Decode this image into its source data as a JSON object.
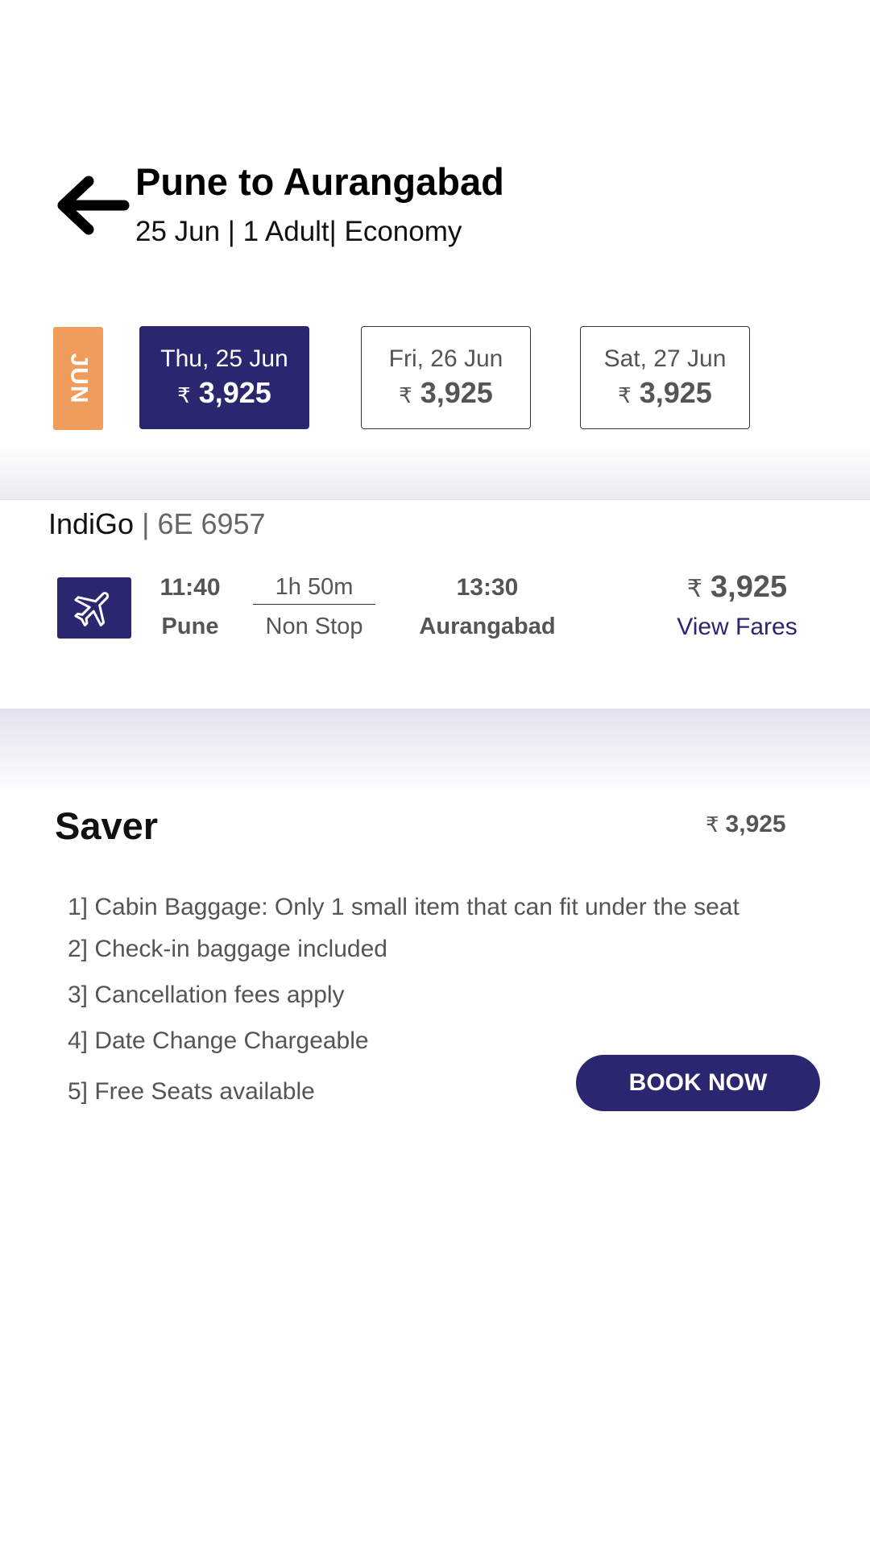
{
  "header": {
    "title": "Pune to Aurangabad",
    "subtitle": "25 Jun | 1 Adult| Economy"
  },
  "date_strip": {
    "month_tag": "JUN",
    "currency": "₹",
    "dates": [
      {
        "day": "Thu, 25 Jun",
        "price": "3,925",
        "selected": true
      },
      {
        "day": "Fri, 26 Jun",
        "price": "3,925",
        "selected": false
      },
      {
        "day": "Sat, 27 Jun",
        "price": "3,925",
        "selected": false
      }
    ]
  },
  "flight": {
    "airline": "IndiGo",
    "separator": " | ",
    "flight_no": "6E 6957",
    "icon": "airplane-icon",
    "departure_time": "11:40",
    "departure_city": "Pune",
    "duration": "1h 50m",
    "stops": "Non Stop",
    "arrival_time": "13:30",
    "arrival_city": "Aurangabad",
    "currency": "₹",
    "price": "3,925",
    "view_fares_label": "View Fares"
  },
  "fare_option": {
    "name": "Saver",
    "currency": "₹",
    "price": "3,925",
    "features": [
      "1] Cabin Baggage: Only 1 small item that can fit under the seat",
      "2] Check-in baggage included",
      "3] Cancellation fees apply",
      "4] Date Change Chargeable",
      "5] Free Seats available"
    ],
    "book_label": "BOOK NOW"
  },
  "colors": {
    "primary": "#2b2670",
    "month_tag": "#f09d5b",
    "muted_text": "#555555"
  }
}
